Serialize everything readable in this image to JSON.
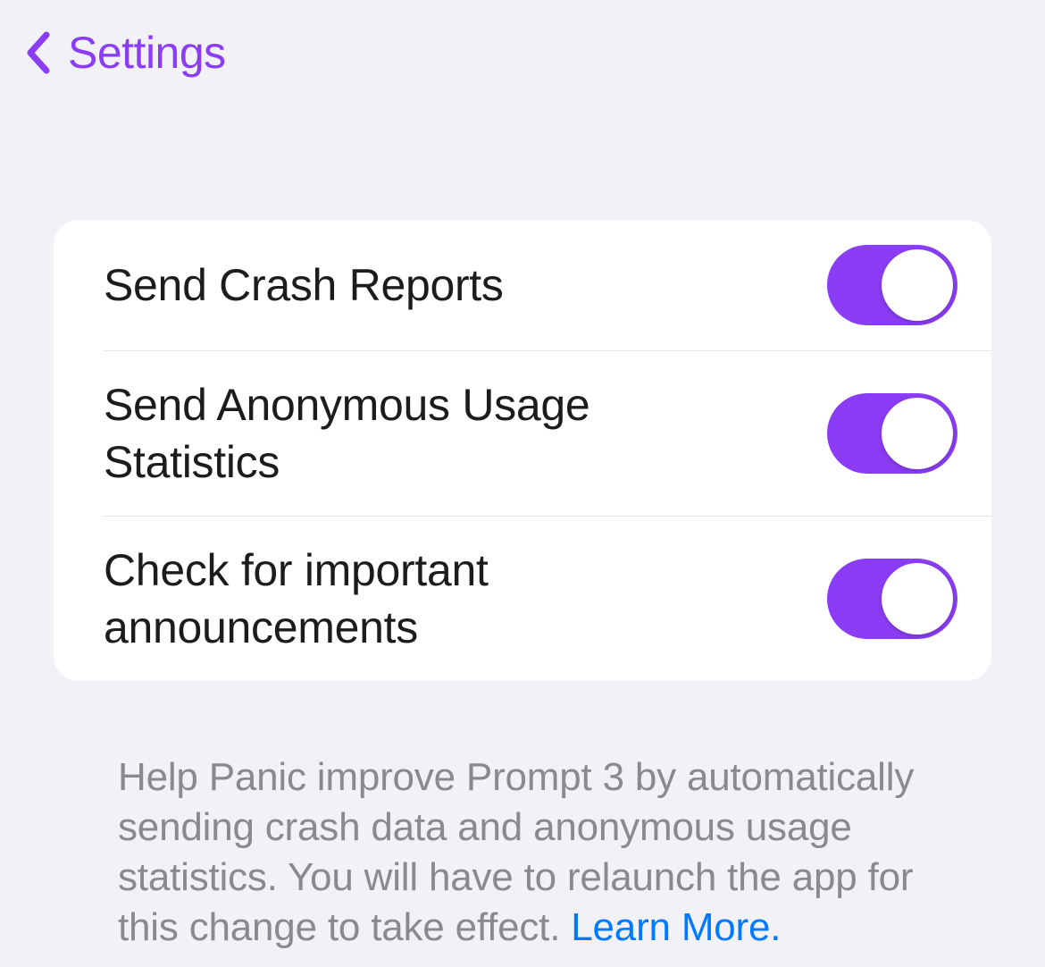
{
  "nav": {
    "back_label": "Settings"
  },
  "settings": {
    "items": [
      {
        "label": "Send Crash Reports",
        "on": true
      },
      {
        "label": "Send Anonymous Usage Statistics",
        "on": true
      },
      {
        "label": "Check for important announcements",
        "on": true
      }
    ]
  },
  "footer": {
    "text": "Help Panic improve Prompt 3 by automatically sending crash data and anonymous usage statistics. You will have to relaunch the app for this change to take effect. ",
    "link_text": "Learn More."
  },
  "colors": {
    "accent": "#8b3df5",
    "link": "#007aff",
    "background": "#f2f1f6"
  }
}
